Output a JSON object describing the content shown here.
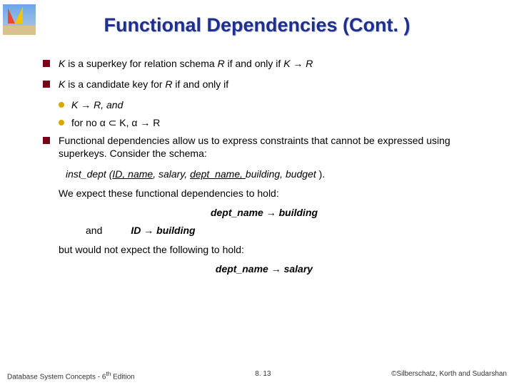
{
  "title": "Functional Dependencies (Cont. )",
  "bullets": {
    "b1_pre": "K",
    "b1_mid": " is a superkey for relation schema ",
    "b1_R": "R",
    "b1_post": " if and only if ",
    "b1_fd": "K → R",
    "b2_pre": "K",
    "b2_mid": " is a candidate key for ",
    "b2_R": "R",
    "b2_post": " if and only if",
    "b2a": "K → R, and",
    "b2b": "for no α ⊂ K,  α → R",
    "b3": "Functional dependencies allow us to express constraints that cannot be expressed using superkeys.  Consider the schema:",
    "schema_pre": "inst_dept (",
    "schema_ul1": "ID,  name",
    "schema_mid1": ", ",
    "schema_i1": "salary",
    "schema_mid2": ", ",
    "schema_ul2": "dept_name, ",
    "schema_i2": "building",
    "schema_mid3": ", ",
    "schema_i3": "budget",
    "schema_post": " ).",
    "expect": "We expect these functional dependencies to hold:",
    "fd1": "dept_name → building",
    "and": "and",
    "fd2": "ID →  building",
    "butnot": "but would not expect the following to hold:",
    "fd3": "dept_name → salary"
  },
  "footer": {
    "left_pre": "Database System Concepts - 6",
    "left_sup": "th",
    "left_post": " Edition",
    "center": "8. 13",
    "right": "©Silberschatz, Korth and Sudarshan"
  }
}
